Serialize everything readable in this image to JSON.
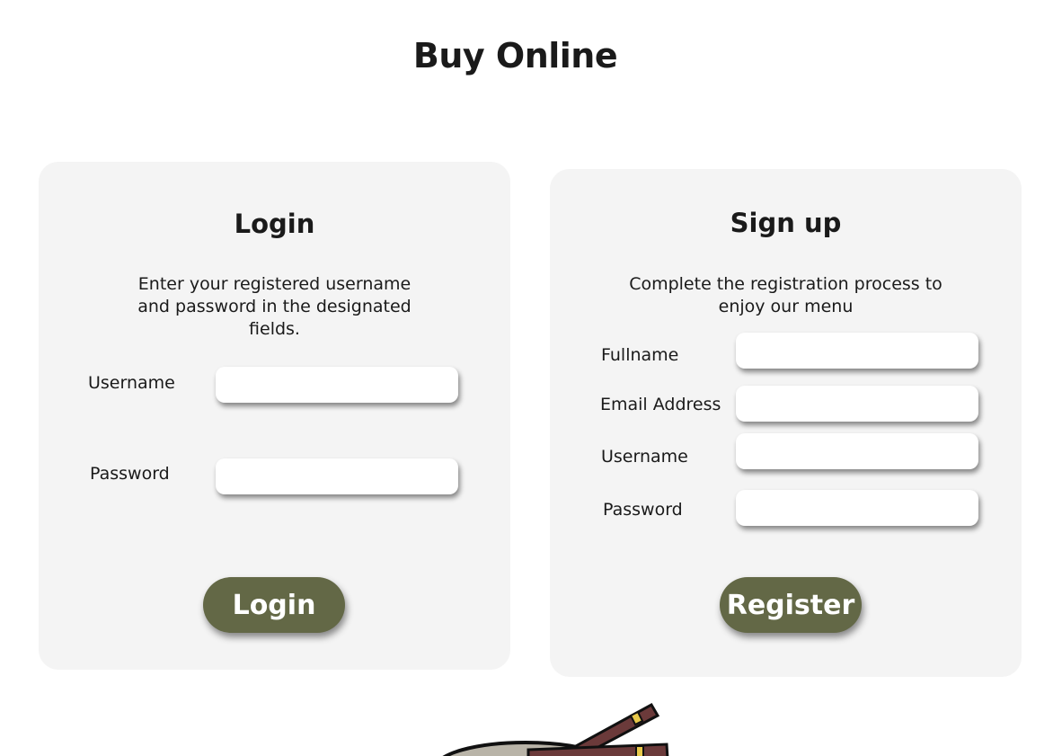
{
  "page": {
    "title": "Buy Online"
  },
  "login": {
    "title": "Login",
    "description": "Enter your registered username and password in the designated fields.",
    "fields": [
      {
        "label": "Username",
        "value": "",
        "placeholder": ""
      },
      {
        "label": "Password",
        "value": "",
        "placeholder": ""
      }
    ],
    "button_label": "Login"
  },
  "signup": {
    "title": "Sign up",
    "description": "Complete the registration process to enjoy our menu",
    "fields": [
      {
        "label": "Fullname",
        "value": "",
        "placeholder": ""
      },
      {
        "label": "Email Address",
        "value": "",
        "placeholder": ""
      },
      {
        "label": "Username",
        "value": "",
        "placeholder": ""
      },
      {
        "label": "Password",
        "value": "",
        "placeholder": ""
      }
    ],
    "button_label": "Register"
  },
  "colors": {
    "button_bg": "#636846",
    "card_bg": "#f4f4f4",
    "text": "#1a1a1a"
  },
  "illustration": {
    "icon": "noodle-bowl-chopsticks-icon"
  }
}
